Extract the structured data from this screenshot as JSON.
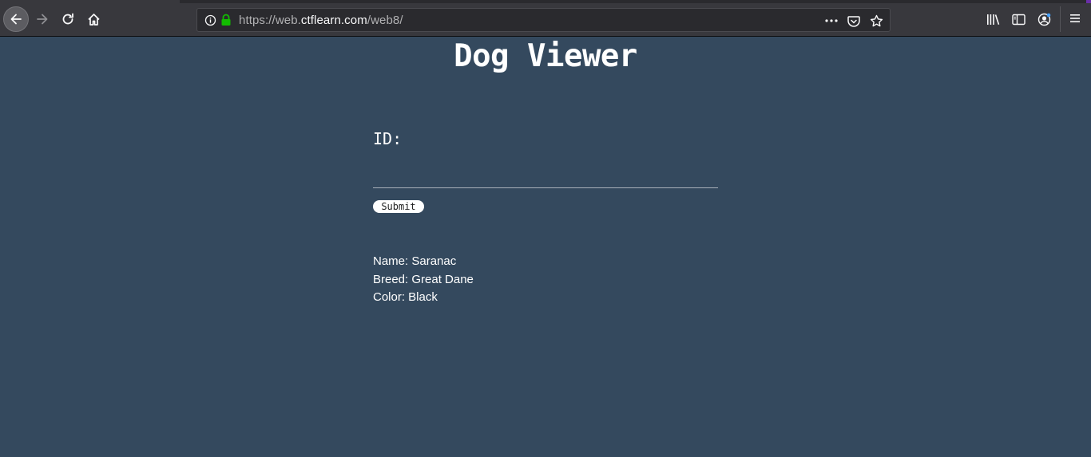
{
  "browser": {
    "url_scheme": "https://",
    "url_prefix": "web.",
    "url_host": "ctflearn.com",
    "url_path": "/web8/",
    "icons": [
      "back-icon",
      "forward-icon",
      "reload-icon",
      "home-icon",
      "info-icon",
      "lock-icon",
      "page-actions-icon",
      "pocket-icon",
      "bookmark-star-icon",
      "library-icon",
      "sidebar-icon",
      "account-icon",
      "menu-icon"
    ]
  },
  "page": {
    "title": "Dog Viewer",
    "form": {
      "id_label": "ID:",
      "id_value": "",
      "submit_label": "Submit"
    },
    "result": {
      "name": "Name: Saranac",
      "breed": "Breed: Great Dane",
      "color": "Color: Black"
    }
  },
  "colors": {
    "page_background": "#34495e",
    "chrome_background": "#38383d",
    "lock_green": "#12bc00"
  }
}
